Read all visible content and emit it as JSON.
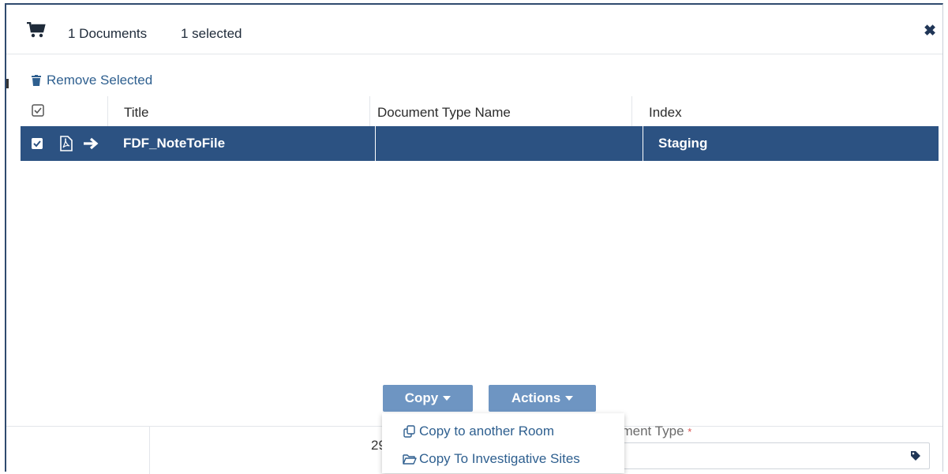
{
  "header": {
    "doc_count": "1 Documents",
    "selected_count": "1 selected",
    "close": "✖"
  },
  "toolbar": {
    "remove_selected": "Remove Selected"
  },
  "grid": {
    "columns": [
      "Title",
      "Document Type Name",
      "Index"
    ],
    "rows": [
      {
        "title": "FDF_NoteToFile",
        "document_type_name": "",
        "index": "Staging",
        "checked": true
      }
    ]
  },
  "buttons": {
    "copy": "Copy",
    "actions": "Actions"
  },
  "copy_menu": {
    "items": [
      "Copy to another Room",
      "Copy To Investigative Sites"
    ]
  },
  "lower_form": {
    "value_fragment": "29",
    "doc_type_label": "ument Type",
    "required_marker": "*"
  },
  "colors": {
    "selected_row": "#2c5282",
    "button": "#6e95c2",
    "link": "#2e5f8f"
  },
  "icons": [
    "cart-icon",
    "trash-icon",
    "checkbox-icon",
    "pdf-icon",
    "arrow-right-icon",
    "caret-down-icon",
    "copy-icon",
    "folder-open-icon",
    "tag-icon"
  ]
}
